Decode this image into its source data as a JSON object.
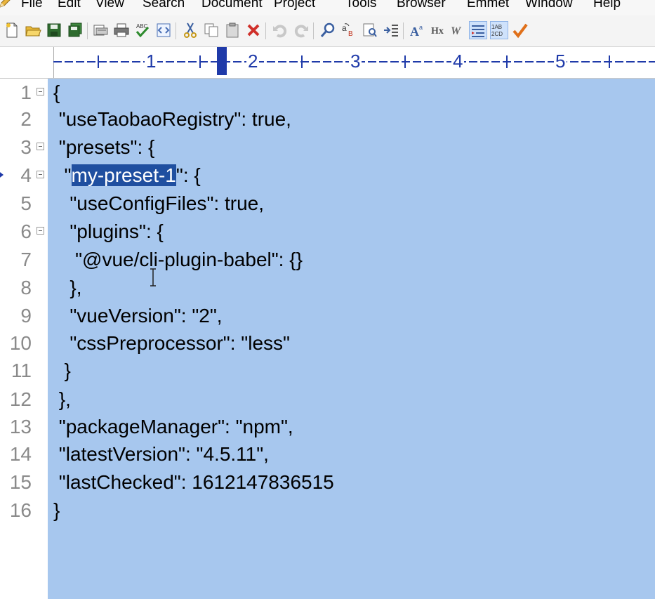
{
  "menu": {
    "items": [
      "File",
      "Edit",
      "View",
      "Search",
      "Document",
      "Project",
      "Tools",
      "Browser",
      "Emmet",
      "Window",
      "Help"
    ]
  },
  "toolbar": {
    "buttons": [
      "new-file",
      "open-file",
      "save",
      "save-all",
      "print-preview",
      "print",
      "spell-check",
      "toggle-panel",
      "cut",
      "copy",
      "paste",
      "delete",
      "undo",
      "redo",
      "find",
      "replace",
      "find-in-files",
      "go-to",
      "font",
      "heading",
      "word-wrap",
      "indent",
      "line-numbers",
      "check"
    ]
  },
  "ruler": {
    "numbers": [
      "1",
      "2",
      "3",
      "4",
      "5"
    ]
  },
  "editor": {
    "lines": [
      {
        "num": "1",
        "text": "{",
        "fold": true
      },
      {
        "num": "2",
        "text": " \"useTaobaoRegistry\": true,",
        "fold": false
      },
      {
        "num": "3",
        "text": " \"presets\": {",
        "fold": true
      },
      {
        "num": "4",
        "pre": "  \"",
        "sel": "my-preset-1",
        "post": "\": {",
        "fold": true,
        "bookmark": true
      },
      {
        "num": "5",
        "text": "   \"useConfigFiles\": true,",
        "fold": false
      },
      {
        "num": "6",
        "text": "   \"plugins\": {",
        "fold": true
      },
      {
        "num": "7",
        "text": "    \"@vue/cli-plugin-babel\": {}",
        "fold": false
      },
      {
        "num": "8",
        "text": "   },",
        "fold": false
      },
      {
        "num": "9",
        "text": "   \"vueVersion\": \"2\",",
        "fold": false
      },
      {
        "num": "10",
        "text": "   \"cssPreprocessor\": \"less\"",
        "fold": false
      },
      {
        "num": "11",
        "text": "  }",
        "fold": false
      },
      {
        "num": "12",
        "text": " },",
        "fold": false
      },
      {
        "num": "13",
        "text": " \"packageManager\": \"npm\",",
        "fold": false
      },
      {
        "num": "14",
        "text": " \"latestVersion\": \"4.5.11\",",
        "fold": false
      },
      {
        "num": "15",
        "text": " \"lastChecked\": 1612147836515",
        "fold": false
      },
      {
        "num": "16",
        "text": "}",
        "fold": false
      }
    ]
  },
  "colors": {
    "selection": "#a7c7ee",
    "highlight": "#1f4fa0",
    "ruler_text": "#1f3aa9",
    "line_number": "#8a8a8a"
  }
}
